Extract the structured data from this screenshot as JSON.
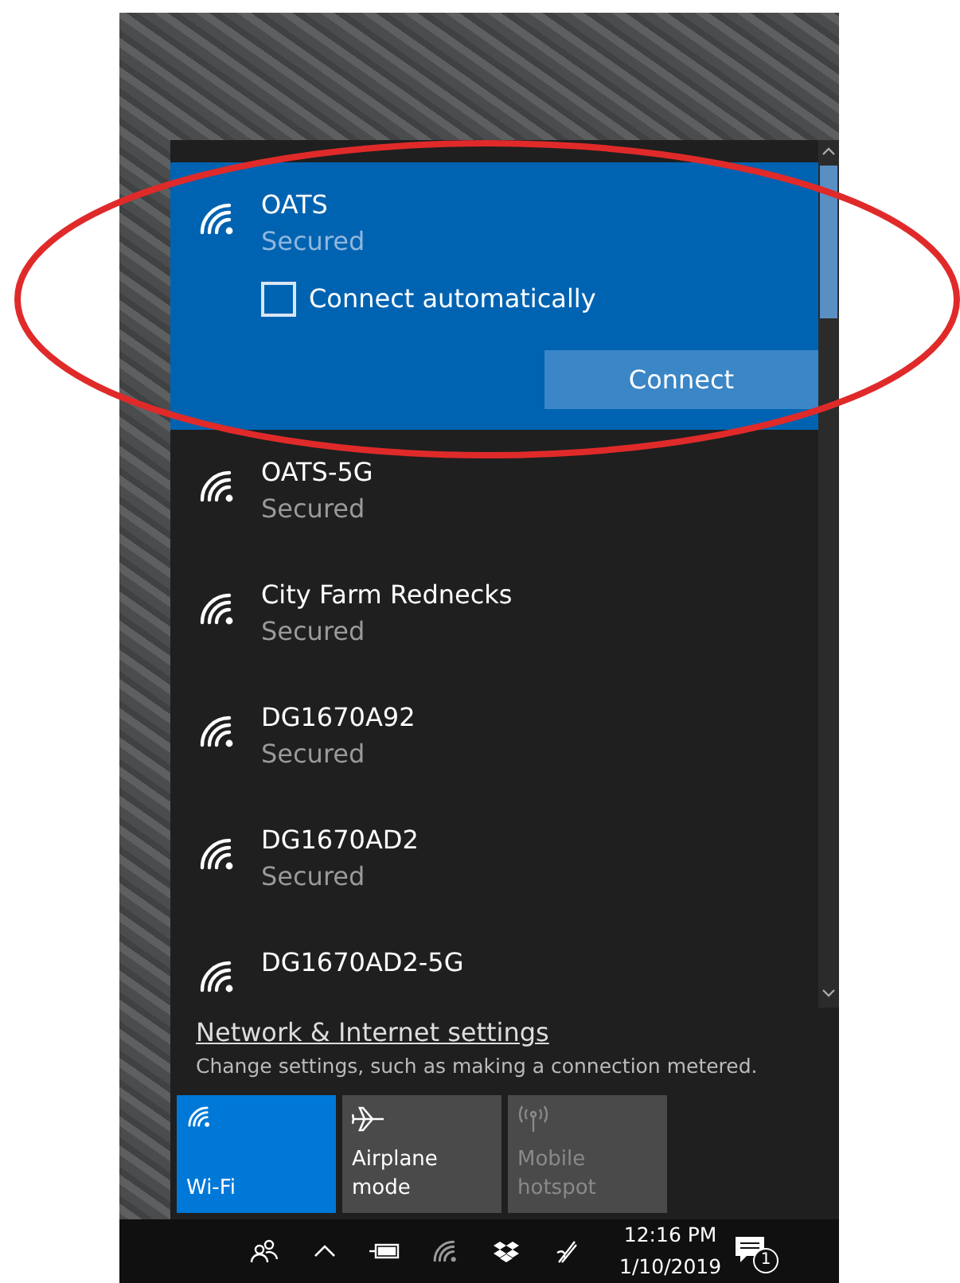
{
  "networks": [
    {
      "name": "OATS",
      "status": "Secured",
      "selected": true,
      "connect_automatically": {
        "label": "Connect automatically",
        "checked": false
      },
      "action": "Connect"
    },
    {
      "name": "OATS-5G",
      "status": "Secured",
      "selected": false
    },
    {
      "name": "City Farm Rednecks",
      "status": "Secured",
      "selected": false
    },
    {
      "name": "DG1670A92",
      "status": "Secured",
      "selected": false
    },
    {
      "name": "DG1670AD2",
      "status": "Secured",
      "selected": false
    },
    {
      "name": "DG1670AD2-5G",
      "selected": false
    }
  ],
  "settings": {
    "link": "Network & Internet settings",
    "description": "Change settings, such as making a connection metered."
  },
  "quick_actions": [
    {
      "kind": "wifi",
      "label": "Wi-Fi",
      "on": true,
      "disabled": false
    },
    {
      "kind": "airplane",
      "label": "Airplane mode",
      "on": false,
      "disabled": false
    },
    {
      "kind": "hotspot",
      "label": "Mobile hotspot",
      "on": false,
      "disabled": true
    }
  ],
  "taskbar": {
    "time": "12:16 PM",
    "date": "1/10/2019",
    "notification_count": "1"
  }
}
